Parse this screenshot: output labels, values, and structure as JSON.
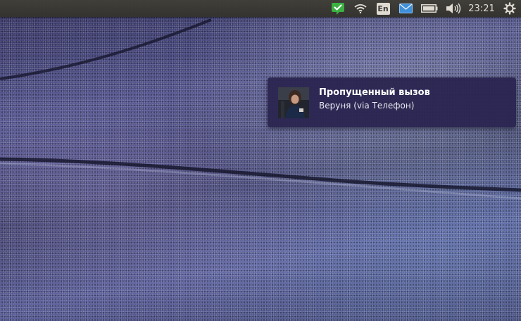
{
  "tray": {
    "keyboard_layout": "En",
    "clock": "23:21",
    "icons": [
      "messaging-status-icon",
      "wifi-icon",
      "keyboard-layout-icon",
      "mail-icon",
      "battery-icon",
      "volume-icon",
      "settings-gear-icon"
    ],
    "accent_green": "#3cb043"
  },
  "notification": {
    "title": "Пропущенный вызов",
    "body": "Веруня (via Телефон)",
    "background": "#2a2550"
  }
}
